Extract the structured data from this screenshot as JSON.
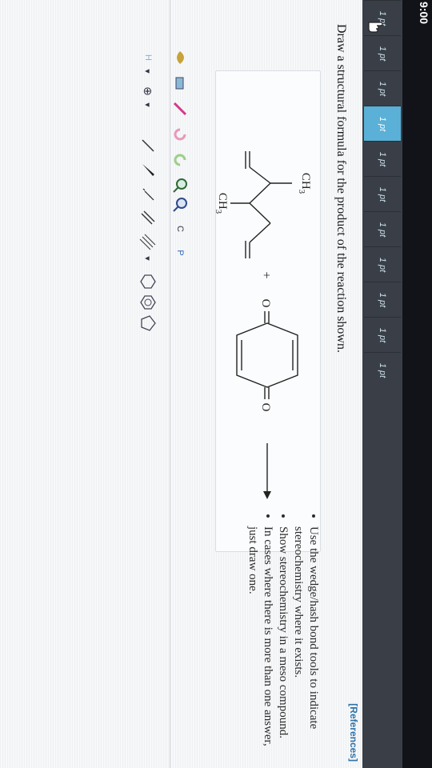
{
  "status": {
    "time": "9:00"
  },
  "sidebar": {
    "items": [
      {
        "label": "1 pt"
      },
      {
        "label": "1 pt"
      },
      {
        "label": "1 pt"
      },
      {
        "label": "1 pt"
      },
      {
        "label": "1 pt"
      },
      {
        "label": "1 pt"
      },
      {
        "label": "1 pt"
      },
      {
        "label": "1 pt"
      },
      {
        "label": "1 pt"
      },
      {
        "label": "1 pt"
      },
      {
        "label": "1 pt"
      }
    ],
    "active_index": 3,
    "active_color": "#5ab0d6"
  },
  "header": {
    "references": "[References]"
  },
  "question": {
    "prompt": "Draw a structural formula for the product of the reaction shown."
  },
  "reaction": {
    "reactant1": {
      "label_top": "CH",
      "sub_top": "3",
      "label_bottom": "CH",
      "sub_bottom": "3"
    },
    "plus": "+",
    "reactant2": {
      "o_top": "O",
      "o_bottom": "O"
    }
  },
  "instructions": [
    "Use the wedge/hash bond tools to indicate stereochemistry where it exists.",
    "Show stereochemistry in a meso compound.",
    "In cases where there is more than one answer, just draw one."
  ],
  "toolbar": {
    "atom_c": "C",
    "atom_h": "H",
    "atom_p": "P",
    "plus_charge": "⊕",
    "dropdown": "▾",
    "ring_icons": [
      "hexagon-icon",
      "pentagon-icon",
      "benzene-icon"
    ]
  }
}
